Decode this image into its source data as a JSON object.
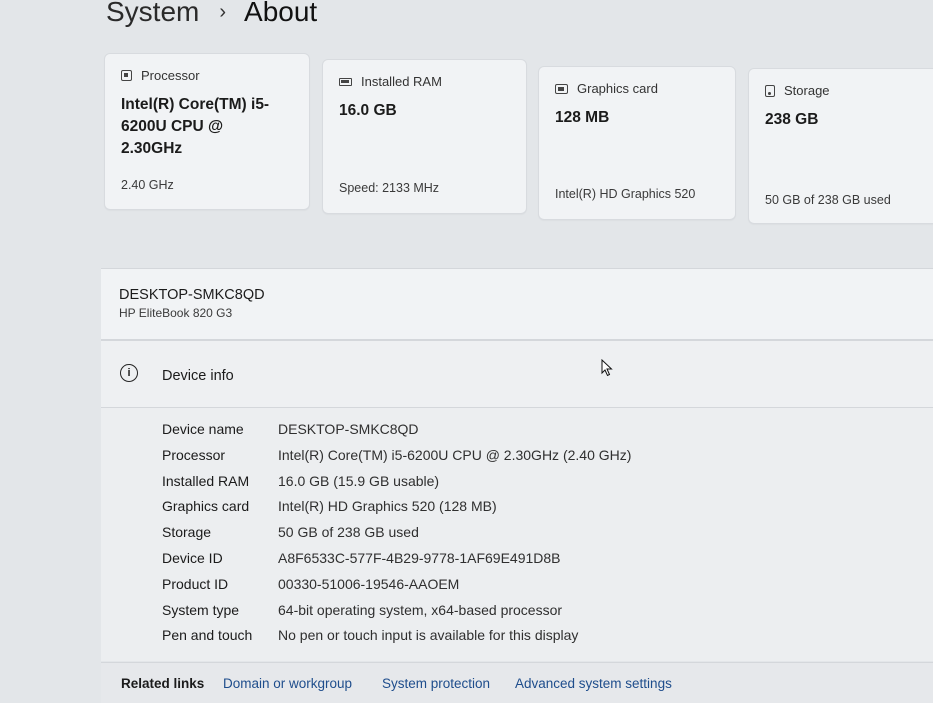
{
  "breadcrumb": {
    "parent": "System",
    "separator": "›",
    "current": "About"
  },
  "cards": [
    {
      "title": "Processor",
      "value": "Intel(R) Core(TM) i5-6200U CPU @ 2.30GHz",
      "sub": "2.40 GHz",
      "icon": "cpu-icon"
    },
    {
      "title": "Installed RAM",
      "value": "16.0 GB",
      "sub": "Speed: 2133 MHz",
      "icon": "ram-icon"
    },
    {
      "title": "Graphics card",
      "value": "128 MB",
      "sub": "Intel(R) HD Graphics 520",
      "icon": "gpu-icon"
    },
    {
      "title": "Storage",
      "value": "238 GB",
      "sub": "50 GB of 238 GB used",
      "icon": "storage-icon"
    }
  ],
  "device": {
    "name": "DESKTOP-SMKC8QD",
    "model": "HP EliteBook 820 G3"
  },
  "device_info": {
    "title": "Device info",
    "icon": "info-icon",
    "rows": [
      {
        "label": "Device name",
        "value": "DESKTOP-SMKC8QD"
      },
      {
        "label": "Processor",
        "value": "Intel(R) Core(TM) i5-6200U CPU @ 2.30GHz (2.40 GHz)"
      },
      {
        "label": "Installed RAM",
        "value": "16.0 GB (15.9 GB usable)"
      },
      {
        "label": "Graphics card",
        "value": "Intel(R) HD Graphics 520 (128 MB)"
      },
      {
        "label": "Storage",
        "value": "50 GB of 238 GB used"
      },
      {
        "label": "Device ID",
        "value": "A8F6533C-577F-4B29-9778-1AF69E491D8B"
      },
      {
        "label": "Product ID",
        "value": "00330-51006-19546-AAOEM"
      },
      {
        "label": "System type",
        "value": "64-bit operating system, x64-based processor"
      },
      {
        "label": "Pen and touch",
        "value": "No pen or touch input is available for this display"
      }
    ]
  },
  "related_links": {
    "label": "Related links",
    "links": [
      "Domain or workgroup",
      "System protection",
      "Advanced system settings"
    ]
  },
  "colors": {
    "background": "#e3e6e9",
    "card": "#f1f3f5",
    "link": "#1e4d8c"
  }
}
